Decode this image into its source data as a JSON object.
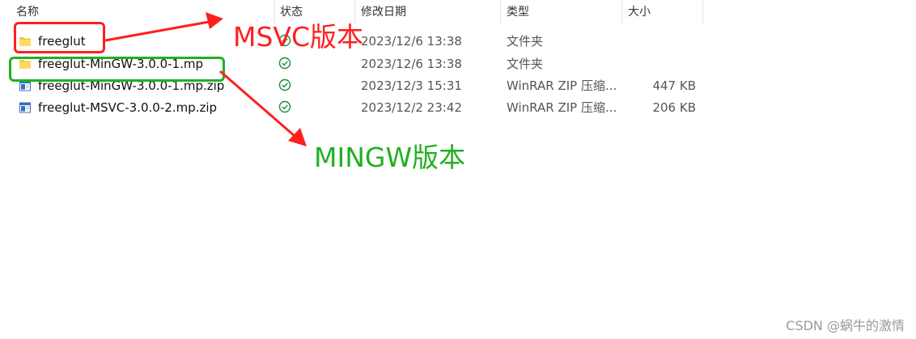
{
  "columns": {
    "name": "名称",
    "status": "状态",
    "modified": "修改日期",
    "type": "类型",
    "size": "大小"
  },
  "files": [
    {
      "name": "freeglut",
      "date": "2023/12/6 13:38",
      "type": "文件夹",
      "size": "",
      "icon": "folder-icon",
      "status_icon": "synced-check-icon"
    },
    {
      "name": "freeglut-MinGW-3.0.0-1.mp",
      "date": "2023/12/6 13:38",
      "type": "文件夹",
      "size": "",
      "icon": "folder-icon",
      "status_icon": "synced-check-icon"
    },
    {
      "name": "freeglut-MinGW-3.0.0-1.mp.zip",
      "date": "2023/12/3 15:31",
      "type": "WinRAR ZIP 压缩...",
      "size": "447 KB",
      "icon": "zip-archive-icon",
      "status_icon": "synced-check-icon"
    },
    {
      "name": "freeglut-MSVC-3.0.0-2.mp.zip",
      "date": "2023/12/2 23:42",
      "type": "WinRAR ZIP 压缩...",
      "size": "206 KB",
      "icon": "zip-archive-icon",
      "status_icon": "synced-check-icon"
    }
  ],
  "annotations": {
    "msvc_label": "MSVC版本",
    "mingw_label": "MINGW版本",
    "red": "#ff1f1f",
    "green": "#22b022"
  },
  "watermark": "CSDN @蜗牛的激情"
}
